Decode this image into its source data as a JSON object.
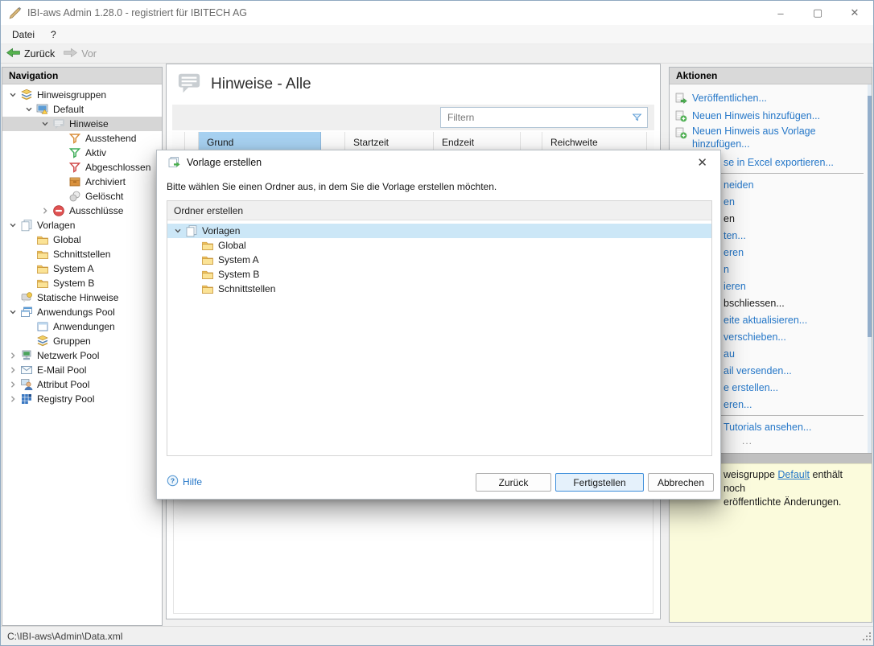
{
  "window": {
    "title": "IBI-aws Admin 1.28.0 - registriert für IBITECH AG",
    "controls": {
      "minimize": "–",
      "maximize": "▢",
      "close": "✕"
    }
  },
  "menu": {
    "items": [
      "Datei",
      "?"
    ]
  },
  "toolbar": {
    "back": "Zurück",
    "forward": "Vor"
  },
  "nav": {
    "header": "Navigation",
    "items": [
      {
        "label": "Hinweisgruppen",
        "icon": "group",
        "level": 0,
        "chev": "down"
      },
      {
        "label": "Default",
        "icon": "monitor-warn",
        "level": 1,
        "chev": "down"
      },
      {
        "label": "Hinweise",
        "icon": "bubble",
        "level": 2,
        "chev": "down",
        "selected": true
      },
      {
        "label": "Ausstehend",
        "icon": "funnel-orange",
        "level": 3
      },
      {
        "label": "Aktiv",
        "icon": "funnel-green",
        "level": 3
      },
      {
        "label": "Abgeschlossen",
        "icon": "funnel-red",
        "level": 3
      },
      {
        "label": "Archiviert",
        "icon": "archive",
        "level": 3
      },
      {
        "label": "Gelöscht",
        "icon": "deleted",
        "level": 3
      },
      {
        "label": "Ausschlüsse",
        "icon": "exclude",
        "level": 2,
        "chev": "right"
      },
      {
        "label": "Vorlagen",
        "icon": "pages",
        "level": 0,
        "chev": "down"
      },
      {
        "label": "Global",
        "icon": "folder",
        "level": 1
      },
      {
        "label": "Schnittstellen",
        "icon": "folder",
        "level": 1
      },
      {
        "label": "System A",
        "icon": "folder",
        "level": 1
      },
      {
        "label": "System B",
        "icon": "folder",
        "level": 1
      },
      {
        "label": "Statische Hinweise",
        "icon": "static",
        "level": 0
      },
      {
        "label": "Anwendungs Pool",
        "icon": "app-pool",
        "level": 0,
        "chev": "down"
      },
      {
        "label": "Anwendungen",
        "icon": "app",
        "level": 1
      },
      {
        "label": "Gruppen",
        "icon": "group",
        "level": 1
      },
      {
        "label": "Netzwerk Pool",
        "icon": "network",
        "level": 0,
        "chev": "right"
      },
      {
        "label": "E-Mail Pool",
        "icon": "mail",
        "level": 0,
        "chev": "right"
      },
      {
        "label": "Attribut Pool",
        "icon": "person",
        "level": 0,
        "chev": "right"
      },
      {
        "label": "Registry Pool",
        "icon": "registry",
        "level": 0,
        "chev": "right"
      }
    ]
  },
  "main": {
    "title": "Hinweise - Alle",
    "filter_placeholder": "Filtern",
    "columns": [
      {
        "label": "Grund",
        "highlighted": true
      },
      {
        "label": "Startzeit"
      },
      {
        "label": "Endzeit"
      },
      {
        "label": "Reichweite"
      }
    ]
  },
  "actions": {
    "header": "Aktionen",
    "items": [
      {
        "type": "link",
        "label": "Veröffentlichen...",
        "icon": "publish"
      },
      {
        "type": "link",
        "label": "Neuen Hinweis hinzufügen...",
        "icon": "add"
      },
      {
        "type": "link",
        "label": "Neuen Hinweis aus Vorlage hinzufügen...",
        "icon": "add",
        "two_line": true
      },
      {
        "type": "link",
        "label": "se in Excel exportieren...",
        "covered": true
      },
      {
        "type": "separator"
      },
      {
        "type": "link",
        "label": "neiden",
        "covered": true
      },
      {
        "type": "link",
        "label": "en",
        "covered": true
      },
      {
        "type": "link",
        "label": "en",
        "covered": true,
        "disabled": true
      },
      {
        "type": "link",
        "label": "ten...",
        "covered": true
      },
      {
        "type": "link",
        "label": "eren",
        "covered": true
      },
      {
        "type": "link",
        "label": "n",
        "covered": true
      },
      {
        "type": "link",
        "label": "ieren",
        "covered": true
      },
      {
        "type": "link",
        "label": "bschliessen...",
        "covered": true,
        "disabled": true
      },
      {
        "type": "link",
        "label": "eite aktualisieren...",
        "covered": true
      },
      {
        "type": "link",
        "label": "verschieben...",
        "covered": true
      },
      {
        "type": "link",
        "label": "au",
        "covered": true
      },
      {
        "type": "link",
        "label": "ail versenden...",
        "covered": true
      },
      {
        "type": "link",
        "label": "e erstellen...",
        "covered": true
      },
      {
        "type": "link",
        "label": "eren...",
        "covered": true
      },
      {
        "type": "separator"
      },
      {
        "type": "link",
        "label": "Tutorials ansehen...",
        "covered": true
      },
      {
        "type": "overflow",
        "label": "..."
      }
    ],
    "note": {
      "text_before": "weisgruppe ",
      "link": "Default",
      "text_after": " enthält noch",
      "line2": "eröffentlichte Änderungen."
    }
  },
  "dialog": {
    "title": "Vorlage erstellen",
    "close_glyph": "✕",
    "description": "Bitte wählen Sie einen Ordner aus, in dem Sie die Vorlage erstellen möchten.",
    "section_header": "Ordner erstellen",
    "tree": [
      {
        "label": "Vorlagen",
        "icon": "pages",
        "level": 0,
        "chev": "down",
        "selected": true
      },
      {
        "label": "Global",
        "icon": "folder",
        "level": 1
      },
      {
        "label": "System A",
        "icon": "folder",
        "level": 1
      },
      {
        "label": "System B",
        "icon": "folder",
        "level": 1
      },
      {
        "label": "Schnittstellen",
        "icon": "folder",
        "level": 1
      }
    ],
    "help_label": "Hilfe",
    "buttons": {
      "back": "Zurück",
      "finish": "Fertigstellen",
      "cancel": "Abbrechen"
    }
  },
  "statusbar": {
    "path": "C:\\IBI-aws\\Admin\\Data.xml"
  }
}
